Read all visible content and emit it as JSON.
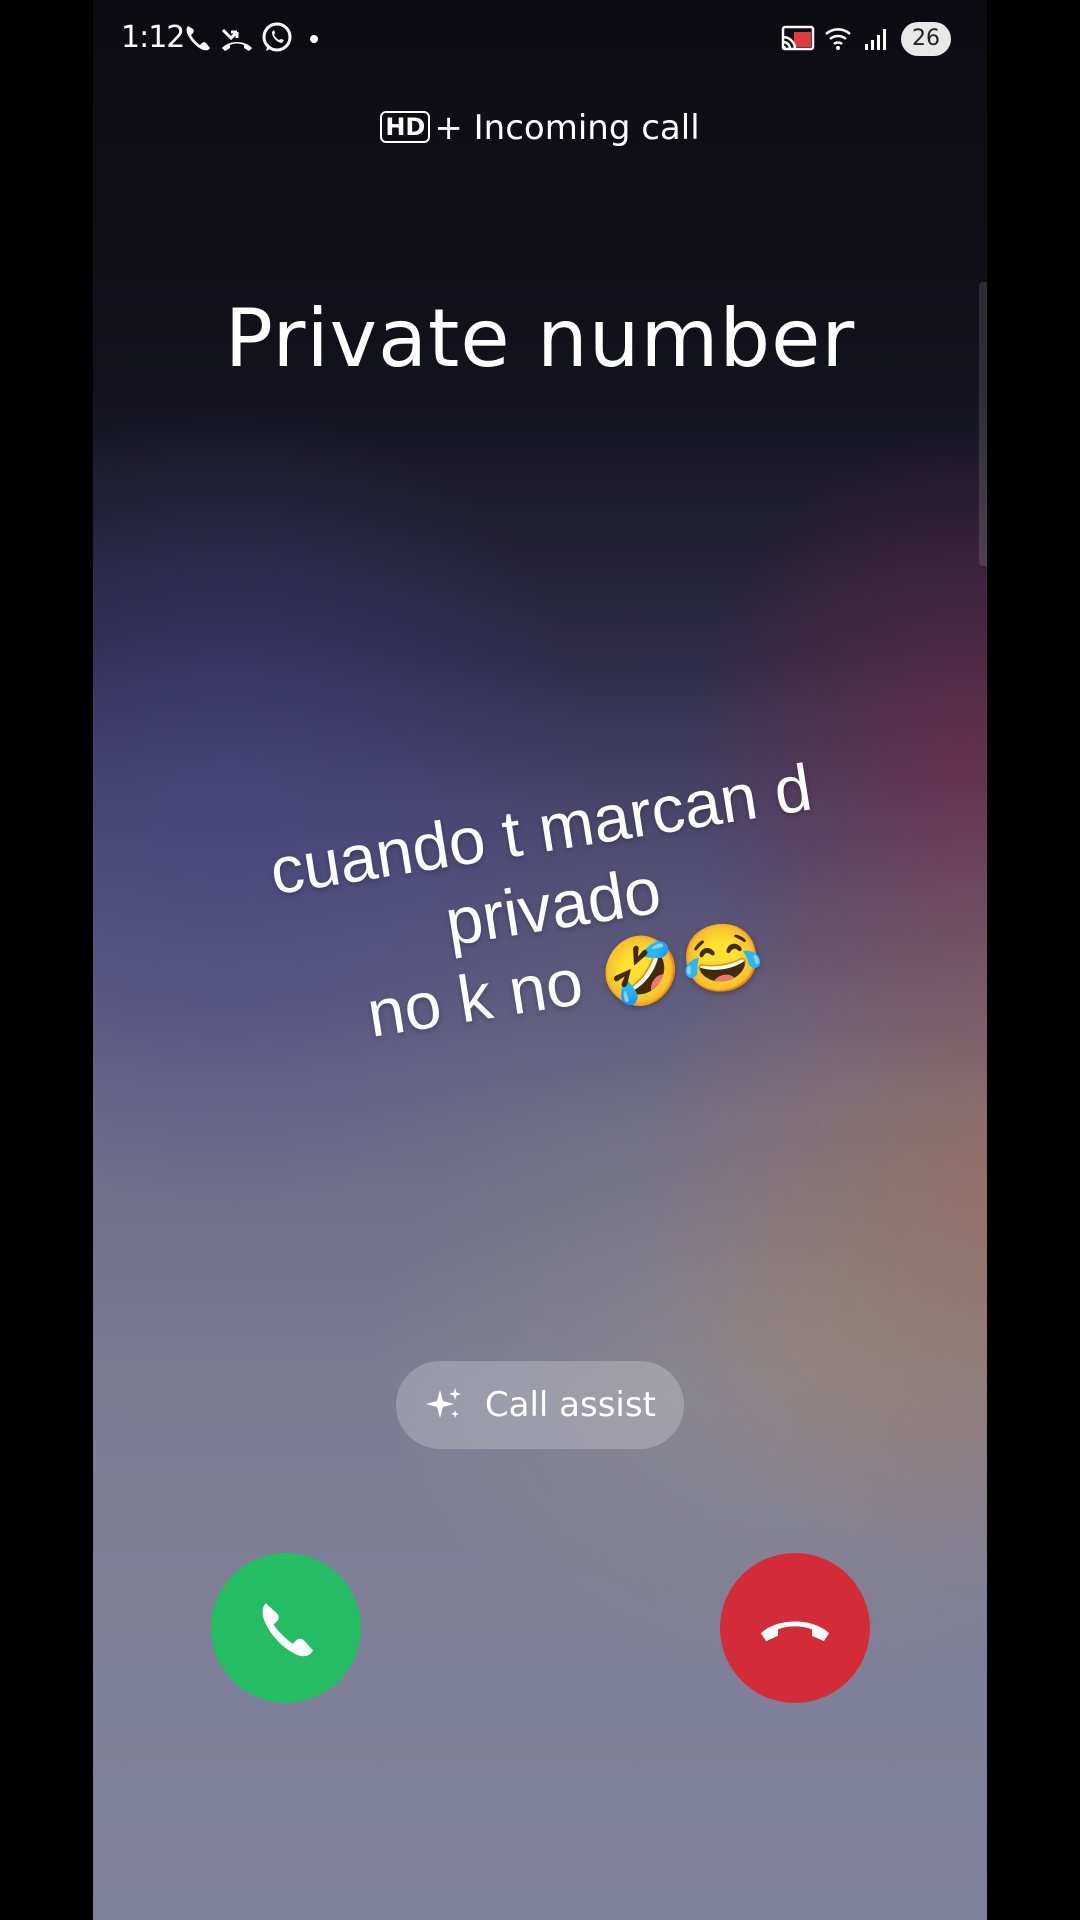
{
  "status_bar": {
    "time": "1:12",
    "battery": "26",
    "left_icons": [
      "phone-icon",
      "missed-call-icon",
      "whatsapp-icon",
      "dot-icon"
    ],
    "right_icons": [
      "cast-icon",
      "wifi-icon",
      "signal-icon",
      "battery-icon"
    ]
  },
  "call": {
    "hd_badge": "HD",
    "hd_plus": "+",
    "status": "Incoming call",
    "caller": "Private number",
    "assist_label": "Call assist",
    "accept_icon": "phone-accept-icon",
    "decline_icon": "phone-decline-icon"
  },
  "overlay_caption": {
    "line1": "cuando t marcan d",
    "line2": "privado",
    "line3": "no k no 🤣😂"
  },
  "colors": {
    "accept": "#24bd63",
    "decline": "#d32b38"
  }
}
